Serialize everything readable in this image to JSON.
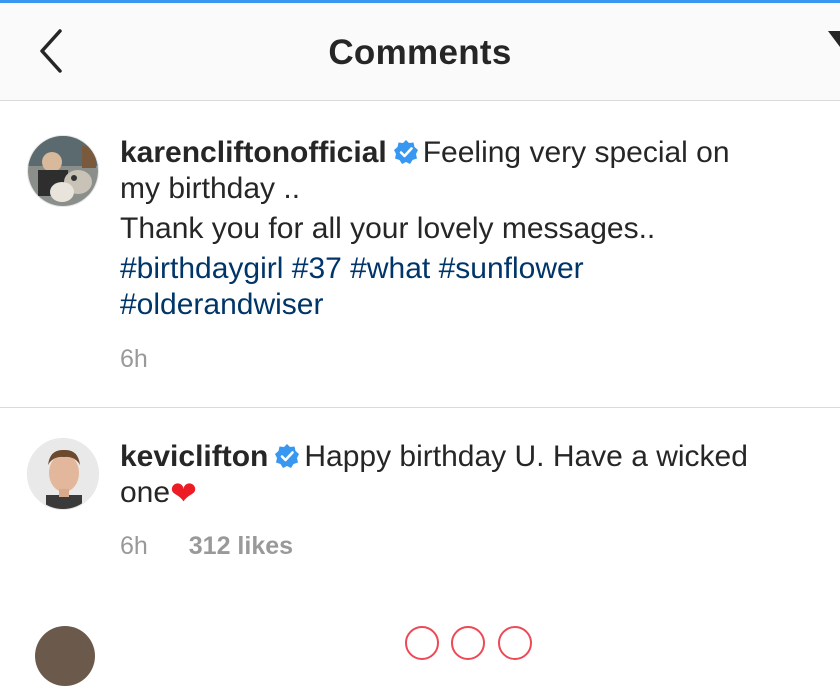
{
  "header": {
    "title": "Comments",
    "back_icon": "chevron-left-icon",
    "send_icon": "direct-send-icon"
  },
  "colors": {
    "accent_blue": "#3897f0",
    "hashtag": "#003569",
    "meta_gray": "#999999",
    "heart_red": "#ed1c24"
  },
  "caption": {
    "username": "karencliftonofficial",
    "verified": true,
    "text_line1": "Feeling very special on",
    "text_line2": "my birthday ..",
    "text_line3": "Thank you for all your lovely messages..",
    "hashtags_line1": [
      "#birthdaygirl",
      "#37",
      "#what",
      "#sunflower"
    ],
    "hashtags_line2": [
      "#olderandwiser"
    ],
    "time": "6h"
  },
  "comments": [
    {
      "username": "keviclifton",
      "verified": true,
      "text_part1": "Happy birthday U. Have a wicked",
      "text_part2": "one",
      "emoji": "❤",
      "time": "6h",
      "likes": "312 likes"
    }
  ]
}
